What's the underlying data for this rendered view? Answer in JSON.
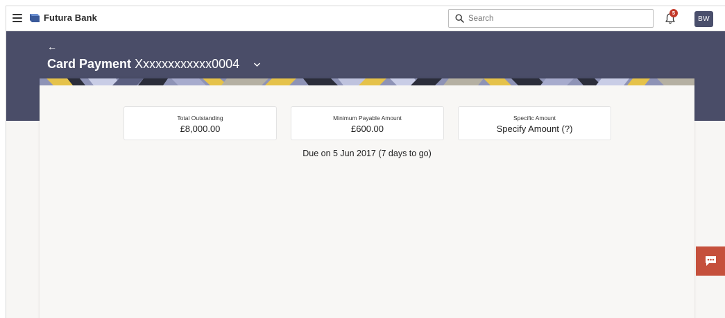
{
  "header": {
    "brand": "Futura Bank",
    "search_placeholder": "Search",
    "notification_count": "5",
    "avatar_initials": "BW"
  },
  "page": {
    "back_label": "←",
    "title_bold": "Card Payment",
    "title_account": "Xxxxxxxxxxxx0004"
  },
  "amounts": [
    {
      "label": "Total Outstanding",
      "value": "£8,000.00"
    },
    {
      "label": "Minimum Payable Amount",
      "value": "£600.00"
    },
    {
      "label": "Specific Amount",
      "value": "Specify Amount (?)"
    }
  ],
  "due_text": "Due on 5 Jun 2017 (7 days to go)",
  "colors": {
    "header_band": "#4a4d68",
    "badge": "#c33b2b",
    "chat_button": "#c5503c",
    "avatar": "#4a4f6c"
  },
  "icons": [
    "hamburger-icon",
    "bank-logo-icon",
    "search-icon",
    "bell-icon",
    "chevron-down-icon",
    "chat-icon"
  ]
}
